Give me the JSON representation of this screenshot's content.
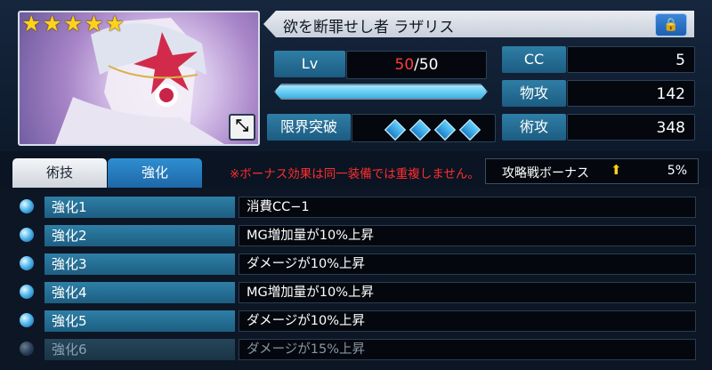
{
  "character": {
    "name": "欲を断罪せし者 ラザリス",
    "rarity_stars": 5,
    "star_glyph": "★"
  },
  "stats": {
    "lv_label": "Lv",
    "lv_current": "50",
    "lv_max": "/50",
    "exp_fill": 1.0,
    "limit_break_label": "限界突破",
    "limit_break_count": 4,
    "cc_label": "CC",
    "cc_value": "5",
    "phys_atk_label": "物攻",
    "phys_atk_value": "142",
    "magic_atk_label": "術攻",
    "magic_atk_value": "348"
  },
  "tabs": [
    {
      "label": "術技",
      "active": false
    },
    {
      "label": "強化",
      "active": true
    }
  ],
  "notice": "※ボーナス効果は同一装備では重複しません。",
  "bonus": {
    "label": "攻略戦ボーナス",
    "icon": "up-arrow-icon",
    "value": "5%"
  },
  "enhancements": [
    {
      "name": "強化1",
      "desc": "消費CC−1",
      "active": true
    },
    {
      "name": "強化2",
      "desc": "MG増加量が10%上昇",
      "active": true
    },
    {
      "name": "強化3",
      "desc": "ダメージが10%上昇",
      "active": true
    },
    {
      "name": "強化4",
      "desc": "MG増加量が10%上昇",
      "active": true
    },
    {
      "name": "強化5",
      "desc": "ダメージが10%上昇",
      "active": true
    },
    {
      "name": "強化6",
      "desc": "ダメージが15%上昇",
      "active": false
    }
  ],
  "icons": {
    "lock": "lock-icon",
    "expand": "expand-icon"
  },
  "colors": {
    "accent": "#1d68a8",
    "lv_current": "#ff3b3b",
    "notice": "#ff2e2e",
    "star": "#ffd21c"
  }
}
